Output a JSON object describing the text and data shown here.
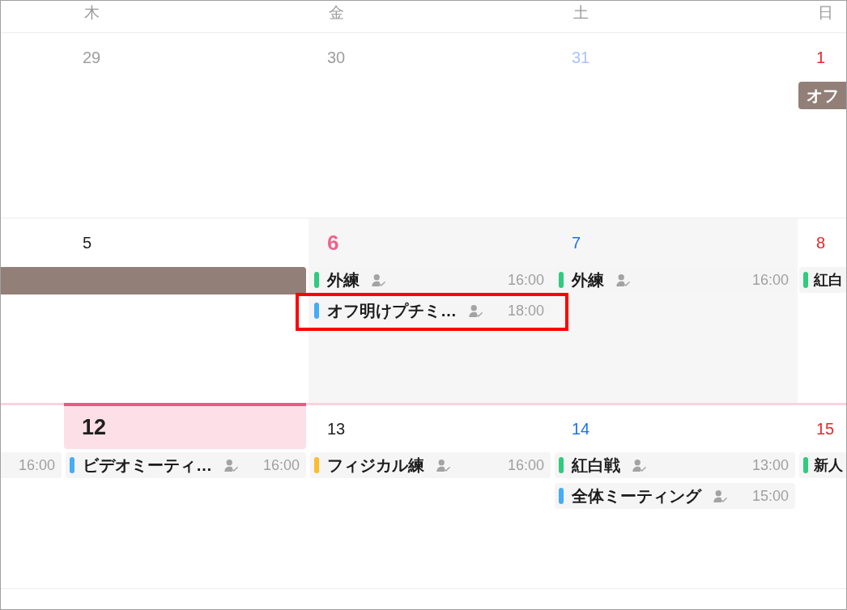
{
  "weekday_headers": [
    "木",
    "金",
    "土",
    "日"
  ],
  "weeks": [
    {
      "current": false,
      "cells": [
        {
          "date": "29",
          "kind": "weekday",
          "other_month": true,
          "selected": false,
          "today": false,
          "shaded": false
        },
        {
          "date": "30",
          "kind": "weekday",
          "other_month": true,
          "selected": false,
          "today": false,
          "shaded": false
        },
        {
          "date": "31",
          "kind": "saturday",
          "other_month": true,
          "selected": false,
          "today": false,
          "shaded": false
        },
        {
          "date": "1",
          "kind": "sunday",
          "other_month": false,
          "selected": false,
          "today": false,
          "shaded": false,
          "banner": {
            "title": "オフ",
            "color": "#927f78"
          }
        }
      ]
    },
    {
      "current": false,
      "leading": {
        "banner": {
          "color": "#927f78"
        }
      },
      "cells": [
        {
          "date": "5",
          "kind": "weekday",
          "other_month": false,
          "selected": false,
          "today": false,
          "shaded": false,
          "banner": {
            "color": "#927f78"
          }
        },
        {
          "date": "6",
          "kind": "weekday",
          "other_month": false,
          "selected": true,
          "today": false,
          "shaded": true,
          "events": [
            {
              "kind": "full",
              "title": "外練",
              "time": "16:00",
              "color": "#2fcb7e",
              "highlighted": false
            },
            {
              "kind": "full",
              "title": "オフ明けプチミ…",
              "time": "18:00",
              "color": "#45acf5",
              "highlighted": true
            }
          ]
        },
        {
          "date": "7",
          "kind": "saturday",
          "other_month": false,
          "selected": false,
          "today": false,
          "shaded": true,
          "events": [
            {
              "kind": "full",
              "title": "外練",
              "time": "16:00",
              "color": "#2fcb7e",
              "highlighted": false
            }
          ]
        },
        {
          "date": "8",
          "kind": "sunday",
          "other_month": false,
          "selected": false,
          "today": false,
          "shaded": false,
          "events": [
            {
              "kind": "title_only",
              "title": "紅白",
              "color": "#2fcb7e",
              "highlighted": false
            }
          ]
        }
      ]
    },
    {
      "current": true,
      "leading": {
        "events": [
          {
            "kind": "time_only",
            "time": "16:00",
            "highlighted": false
          }
        ]
      },
      "cells": [
        {
          "date": "12",
          "kind": "weekday",
          "other_month": false,
          "selected": false,
          "today": true,
          "shaded": false,
          "events": [
            {
              "kind": "full",
              "title": "ビデオミーティ…",
              "time": "16:00",
              "color": "#45acf5",
              "highlighted": false
            }
          ]
        },
        {
          "date": "13",
          "kind": "weekday",
          "other_month": false,
          "selected": false,
          "today": false,
          "shaded": false,
          "events": [
            {
              "kind": "full",
              "title": "フィジカル練",
              "time": "16:00",
              "color": "#fbbd2c",
              "highlighted": false
            }
          ]
        },
        {
          "date": "14",
          "kind": "saturday",
          "other_month": false,
          "selected": false,
          "today": false,
          "shaded": false,
          "events": [
            {
              "kind": "full",
              "title": "紅白戦",
              "time": "13:00",
              "color": "#2fcb7e",
              "highlighted": false
            },
            {
              "kind": "full",
              "title": "全体ミーティング",
              "time": "15:00",
              "color": "#45acf5",
              "highlighted": false
            }
          ]
        },
        {
          "date": "15",
          "kind": "sunday",
          "other_month": false,
          "selected": false,
          "today": false,
          "shaded": false,
          "events": [
            {
              "kind": "title_only",
              "title": "新人",
              "color": "#2fcb7e",
              "highlighted": false
            }
          ]
        }
      ]
    }
  ]
}
